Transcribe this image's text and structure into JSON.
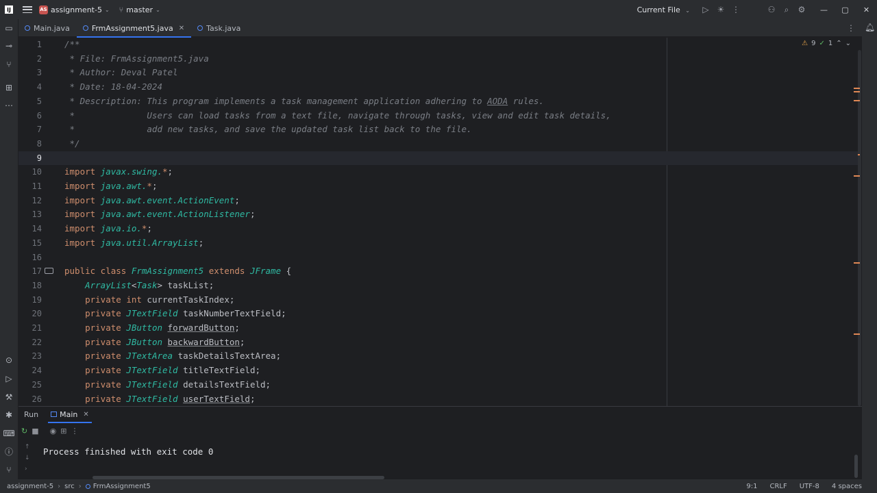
{
  "titlebar": {
    "app_logo": "IJ",
    "project_badge": "AS",
    "project_name": "assignment-5",
    "branch": "master",
    "run_config": "Current File"
  },
  "tabs": [
    {
      "label": "Main.java"
    },
    {
      "label": "FrmAssignment5.java",
      "active": true
    },
    {
      "label": "Task.java"
    }
  ],
  "inspections": {
    "warnings": "9",
    "ok": "1"
  },
  "editor": {
    "line_numbers": [
      "1",
      "2",
      "3",
      "4",
      "5",
      "6",
      "7",
      "8",
      "9",
      "10",
      "11",
      "12",
      "13",
      "14",
      "15",
      "16",
      "17",
      "18",
      "19",
      "20",
      "21",
      "22",
      "23",
      "24",
      "25",
      "26"
    ],
    "current_line": "9"
  },
  "run_panel": {
    "run_label": "Run",
    "tab_label": "Main",
    "output": "Process finished with exit code 0"
  },
  "status": {
    "breadcrumb": [
      "assignment-5",
      "src",
      "FrmAssignment5"
    ],
    "position": "9:1",
    "line_sep": "CRLF",
    "encoding": "UTF-8",
    "indent": "4 spaces"
  },
  "colors": {
    "accent": "#3574f0",
    "keyword": "#cf8e6d",
    "type": "#2fbaa3",
    "comment": "#7a7e85"
  }
}
